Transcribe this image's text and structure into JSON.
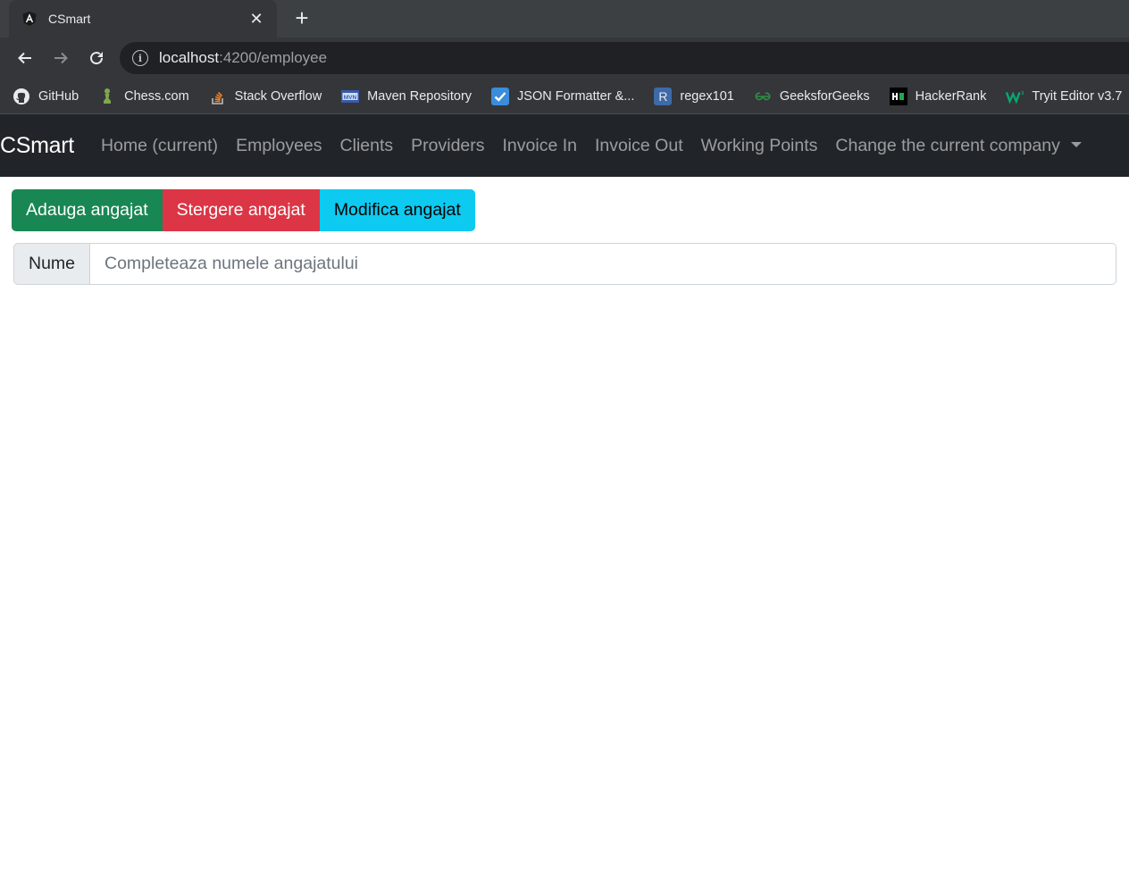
{
  "browser": {
    "tab": {
      "title": "CSmart",
      "favicon": "angular-icon",
      "close_icon": "close-icon"
    },
    "new_tab_icon": "plus-icon",
    "nav": {
      "back_icon": "arrow-left-icon",
      "forward_icon": "arrow-right-icon",
      "reload_icon": "reload-icon"
    },
    "address": {
      "host": "localhost",
      "path": ":4200/employee",
      "info_glyph": "i"
    },
    "bookmarks": [
      {
        "label": "GitHub",
        "icon": "github-icon"
      },
      {
        "label": "Chess.com",
        "icon": "chess-pawn-icon"
      },
      {
        "label": "Stack Overflow",
        "icon": "stackoverflow-icon"
      },
      {
        "label": "Maven Repository",
        "icon": "maven-icon"
      },
      {
        "label": "JSON Formatter &...",
        "icon": "checkmark-icon"
      },
      {
        "label": "regex101",
        "icon": "regex-icon",
        "glyph": "R"
      },
      {
        "label": "GeeksforGeeks",
        "icon": "geeksforgeeks-icon"
      },
      {
        "label": "HackerRank",
        "icon": "hackerrank-icon",
        "glyph": "H"
      },
      {
        "label": "Tryit Editor v3.7",
        "icon": "w3schools-icon",
        "glyph": "W"
      }
    ]
  },
  "navbar": {
    "brand": "CSmart",
    "links": [
      "Home (current)",
      "Employees",
      "Clients",
      "Providers",
      "Invoice In",
      "Invoice Out",
      "Working Points",
      "Change the current company"
    ]
  },
  "actions": {
    "add": "Adauga angajat",
    "delete": "Stergere angajat",
    "modify": "Modifica angajat"
  },
  "name_field": {
    "label": "Nume",
    "value": "",
    "placeholder": "Completeaza numele angajatului"
  },
  "colors": {
    "success": "#198754",
    "danger": "#dc3545",
    "info": "#0dcaf0",
    "navbar_bg": "#212529"
  }
}
